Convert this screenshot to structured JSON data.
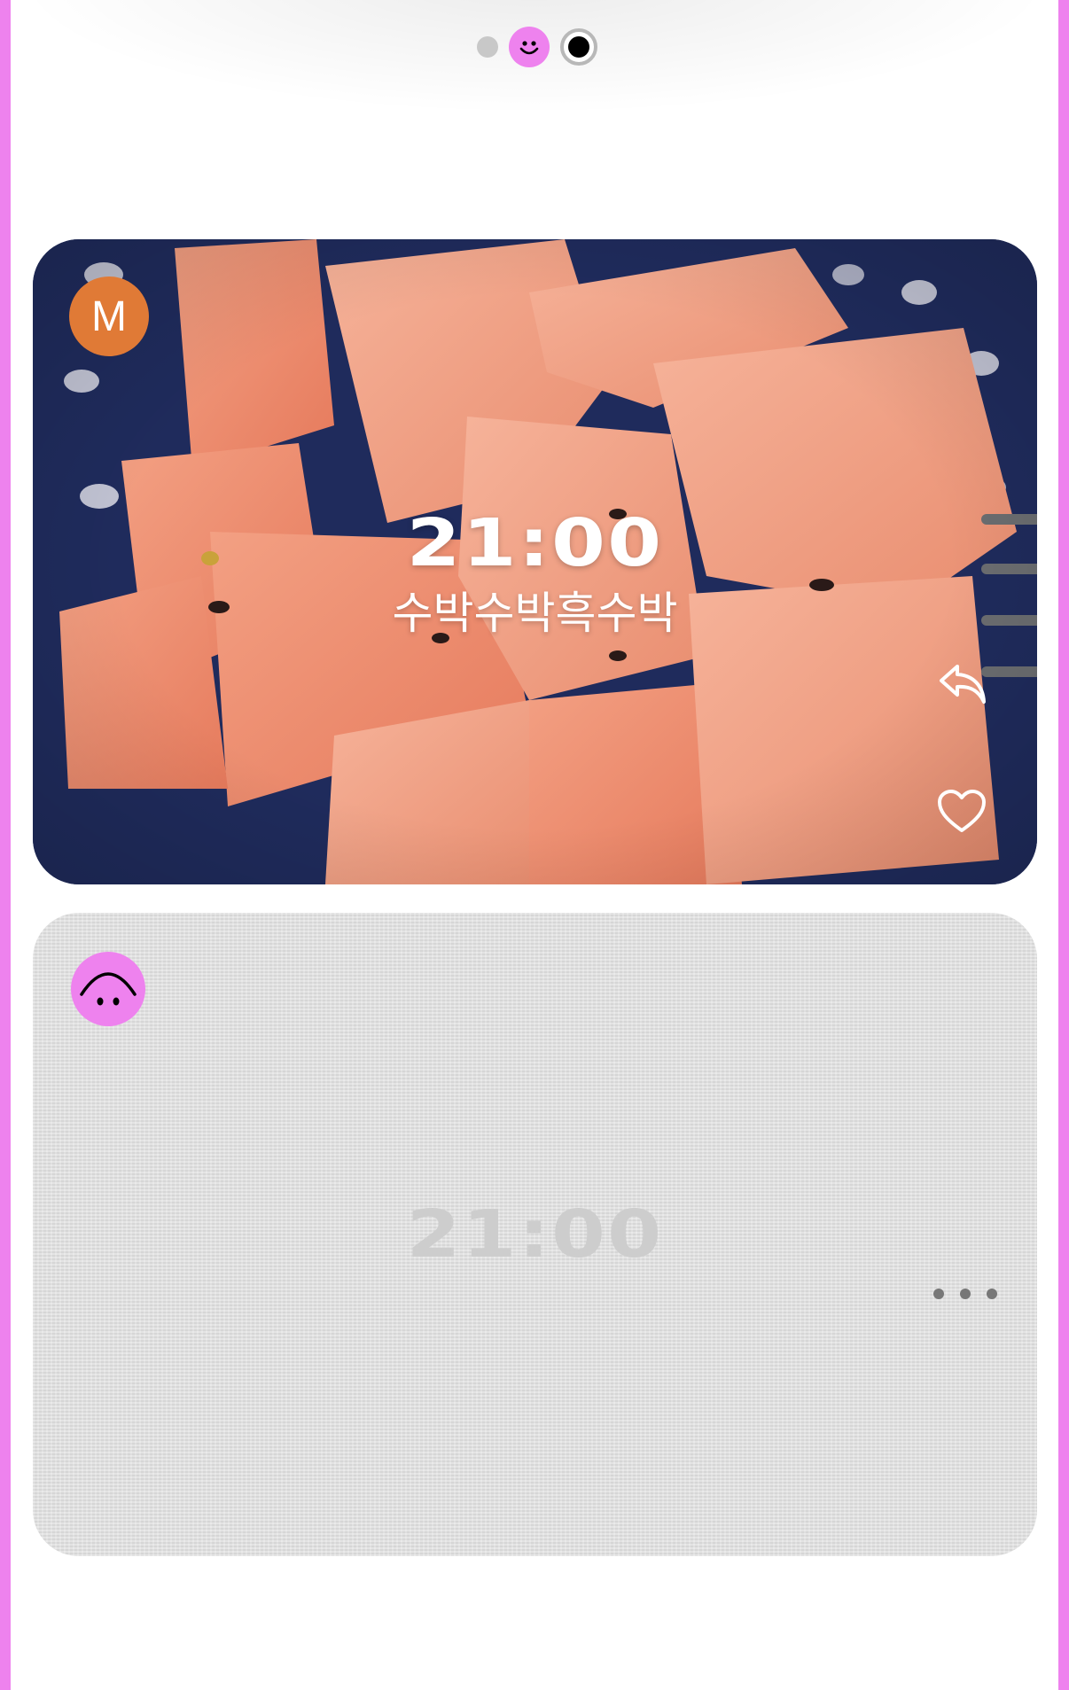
{
  "page_indicator": {
    "pages": [
      "plain-dot",
      "smiley-dot",
      "active-dot"
    ],
    "active_index": 2
  },
  "feed": {
    "cards": [
      {
        "type": "photo",
        "avatar_initial": "M",
        "avatar_color": "#e07a36",
        "time": "21:00",
        "caption": "수박수박흑수박",
        "actions": [
          "reply-icon",
          "heart-icon"
        ]
      },
      {
        "type": "placeholder",
        "avatar_icon": "upside-down-smiley-icon",
        "avatar_color": "#ee82ee",
        "time": "21:00",
        "actions": [
          "more-icon"
        ]
      }
    ]
  },
  "colors": {
    "accent": "#ee82ee",
    "avatar_orange": "#e07a36",
    "placeholder_bg": "#e2e2e2"
  }
}
